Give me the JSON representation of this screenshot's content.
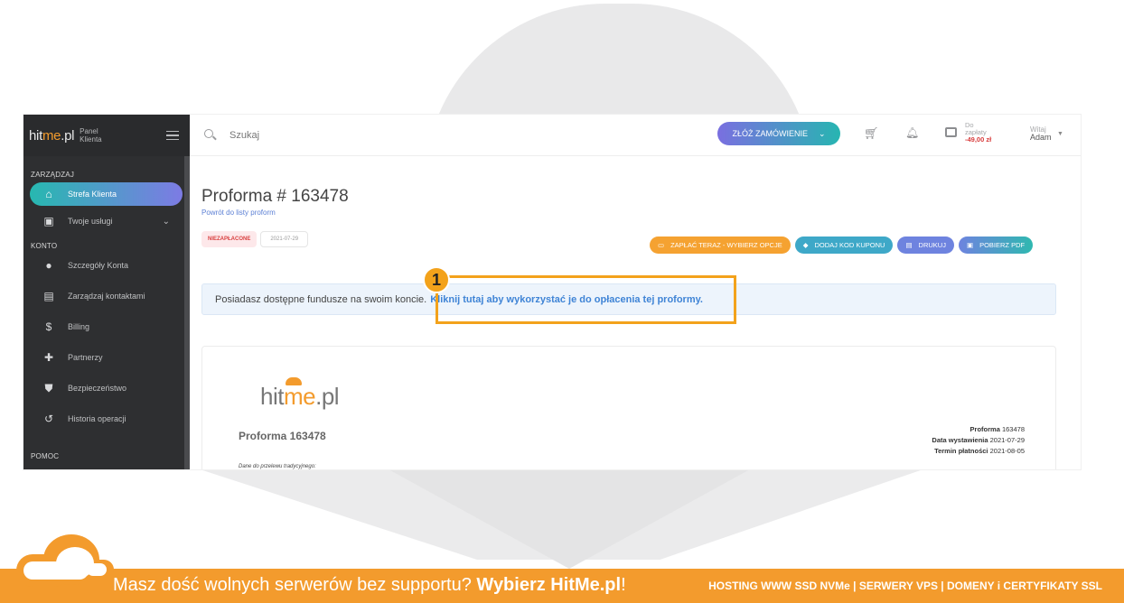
{
  "sidebar": {
    "brand_prefix": "hit",
    "brand_me": "me",
    "brand_suffix": ".pl",
    "panel_line1": "Panel",
    "panel_line2": "Klienta",
    "sections": [
      {
        "heading": "ZARZĄDZAJ",
        "items": [
          {
            "label": "Strefa Klienta",
            "icon": "home-icon",
            "active": true
          },
          {
            "label": "Twoje usługi",
            "icon": "services-icon",
            "has_submenu": true
          }
        ]
      },
      {
        "heading": "KONTO",
        "items": [
          {
            "label": "Szczegóły Konta",
            "icon": "user-icon"
          },
          {
            "label": "Zarządzaj kontaktami",
            "icon": "contacts-icon"
          },
          {
            "label": "Billing",
            "icon": "dollar-icon"
          },
          {
            "label": "Partnerzy",
            "icon": "partners-icon"
          },
          {
            "label": "Bezpieczeństwo",
            "icon": "shield-icon"
          },
          {
            "label": "Historia operacji",
            "icon": "history-icon"
          }
        ]
      },
      {
        "heading": "POMOC"
      }
    ]
  },
  "header": {
    "search_placeholder": "Szukaj",
    "order_button": "ZŁÓŻ ZAMÓWIENIE",
    "due_line1": "Do",
    "due_line2": "zapłaty",
    "due_amount": "-49,00 zł",
    "greeting": "Witaj",
    "user_name": "Adam"
  },
  "invoice_page": {
    "title": "Proforma # 163478",
    "back_link": "Powrót do listy proform",
    "status_badge": "NIEZAPŁACONE",
    "date_badge": "2021-07-29",
    "actions": {
      "pay": "ZAPŁAĆ TERAZ - WYBIERZ OPCJE",
      "coupon": "DODAJ KOD KUPONU",
      "print": "DRUKUJ",
      "pdf": "POBIERZ PDF"
    },
    "funds_notice": "Posiadasz dostępne fundusze na swoim koncie.",
    "funds_link": "Kliknij tutaj aby wykorzystać je do opłacenia tej proformy."
  },
  "invoice_preview": {
    "logo_prefix": "hit",
    "logo_me": "me",
    "logo_suffix": ".pl",
    "heading": "Proforma 163478",
    "meta": [
      {
        "label": "Proforma",
        "value": "163478"
      },
      {
        "label": "Data wystawienia",
        "value": "2021-07-29"
      },
      {
        "label": "Termin płatności",
        "value": "2021-08-05"
      }
    ],
    "transfer_note": "Dane do przelewu tradycyjnego:"
  },
  "callout": {
    "number": "1"
  },
  "footer": {
    "message_prefix": "Masz dość wolnych serwerów bez supportu?",
    "message_bold": "Wybierz HitMe.pl",
    "message_suffix": "!",
    "services": "HOSTING WWW SSD NVMe | SERWERY VPS | DOMENY i CERTYFIKATY SSL"
  },
  "colors": {
    "accent_orange": "#f39b2d",
    "sidebar_bg": "#2e2f31",
    "link_blue": "#3f84d6",
    "unpaid_red": "#d94040"
  }
}
